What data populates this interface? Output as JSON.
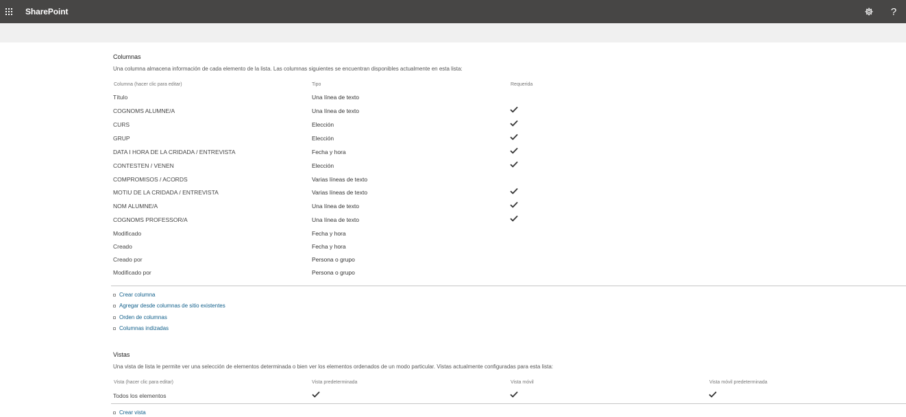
{
  "app": {
    "title": "SharePoint"
  },
  "suitebar": {
    "settings_icon": "gear-icon",
    "help_label": "?"
  },
  "columns_section": {
    "title": "Columnas",
    "description": "Una columna almacena información de cada elemento de la lista. Las columnas siguientes se encuentran disponibles actualmente en esta lista:",
    "headers": {
      "name": "Columna (hacer clic para editar)",
      "type": "Tipo",
      "required": "Requerida"
    },
    "rows": [
      {
        "name": "Título",
        "type": "Una línea de texto",
        "required": false
      },
      {
        "name": "COGNOMS ALUMNE/A",
        "type": "Una línea de texto",
        "required": true
      },
      {
        "name": "CURS",
        "type": "Elección",
        "required": true
      },
      {
        "name": "GRUP",
        "type": "Elección",
        "required": true
      },
      {
        "name": "DATA I HORA DE LA CRIDADA / ENTREVISTA",
        "type": "Fecha y hora",
        "required": true
      },
      {
        "name": "CONTESTEN / VENEN",
        "type": "Elección",
        "required": true
      },
      {
        "name": "COMPROMISOS / ACORDS",
        "type": "Varias líneas de texto",
        "required": false
      },
      {
        "name": "MOTIU DE LA CRIDADA / ENTREVISTA",
        "type": "Varias líneas de texto",
        "required": true
      },
      {
        "name": "NOM ALUMNE/A",
        "type": "Una línea de texto",
        "required": true
      },
      {
        "name": "COGNOMS PROFESSOR/A",
        "type": "Una línea de texto",
        "required": true
      },
      {
        "name": "Modificado",
        "type": "Fecha y hora",
        "required": false
      },
      {
        "name": "Creado",
        "type": "Fecha y hora",
        "required": false
      },
      {
        "name": "Creado por",
        "type": "Persona o grupo",
        "required": false
      },
      {
        "name": "Modificado por",
        "type": "Persona o grupo",
        "required": false
      }
    ],
    "links": [
      {
        "label": "Crear columna"
      },
      {
        "label": "Agregar desde columnas de sitio existentes"
      },
      {
        "label": "Orden de columnas"
      },
      {
        "label": "Columnas indizadas"
      }
    ]
  },
  "views_section": {
    "title": "Vistas",
    "description": "Una vista de lista le permite ver una selección de elementos determinada o bien ver los elementos ordenados de un modo particular. Vistas actualmente configuradas para esta lista:",
    "headers": {
      "name": "Vista (hacer clic para editar)",
      "default": "Vista predeterminada",
      "mobile": "Vista móvil",
      "mobile_default": "Vista móvil predeterminada"
    },
    "rows": [
      {
        "name": "Todos los elementos",
        "default": true,
        "mobile": true,
        "mobile_default": true
      }
    ],
    "links": [
      {
        "label": "Crear vista"
      }
    ]
  },
  "colors": {
    "suitebar": "#474645",
    "subbar": "#f0f0f0",
    "link": "#0f5e8a",
    "check": "#333333"
  }
}
